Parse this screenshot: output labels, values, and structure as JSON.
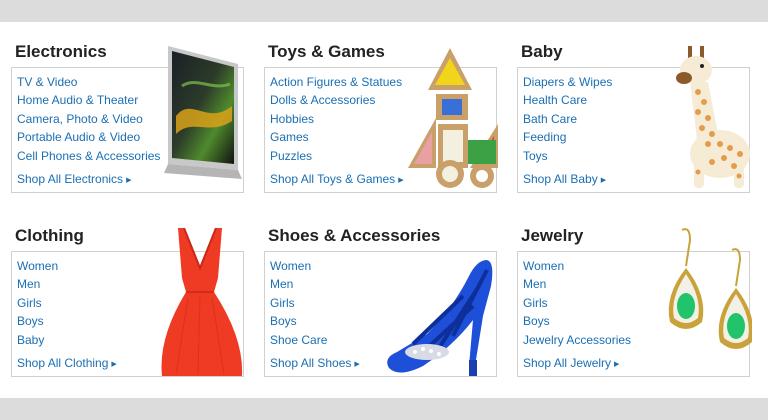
{
  "categories": [
    {
      "title": "Electronics",
      "links": [
        "TV & Video",
        "Home Audio & Theater",
        "Camera, Photo & Video",
        "Portable Audio & Video",
        "Cell Phones & Accessories"
      ],
      "shop_all": "Shop All Electronics",
      "image": "laptop-image"
    },
    {
      "title": "Toys & Games",
      "links": [
        "Action Figures & Statues",
        "Dolls & Accessories",
        "Hobbies",
        "Games",
        "Puzzles"
      ],
      "shop_all": "Shop All Toys & Games",
      "image": "wooden-blocks-image"
    },
    {
      "title": "Baby",
      "links": [
        "Diapers & Wipes",
        "Health Care",
        "Bath Care",
        "Feeding",
        "Toys"
      ],
      "shop_all": "Shop All Baby",
      "image": "toy-giraffe-image"
    },
    {
      "title": "Clothing",
      "links": [
        "Women",
        "Men",
        "Girls",
        "Boys",
        "Baby"
      ],
      "shop_all": "Shop All Clothing",
      "image": "red-dress-image"
    },
    {
      "title": "Shoes & Accessories",
      "links": [
        "Women",
        "Men",
        "Girls",
        "Boys",
        "Shoe Care"
      ],
      "shop_all": "Shop All Shoes",
      "image": "blue-heel-image"
    },
    {
      "title": "Jewelry",
      "links": [
        "Women",
        "Men",
        "Girls",
        "Boys",
        "Jewelry Accessories"
      ],
      "shop_all": "Shop All Jewelry",
      "image": "green-earrings-image"
    }
  ],
  "colors": {
    "link": "#1a6fb3",
    "heading": "#222222",
    "border": "#d0d0d0",
    "background": "#dcdcdc"
  }
}
